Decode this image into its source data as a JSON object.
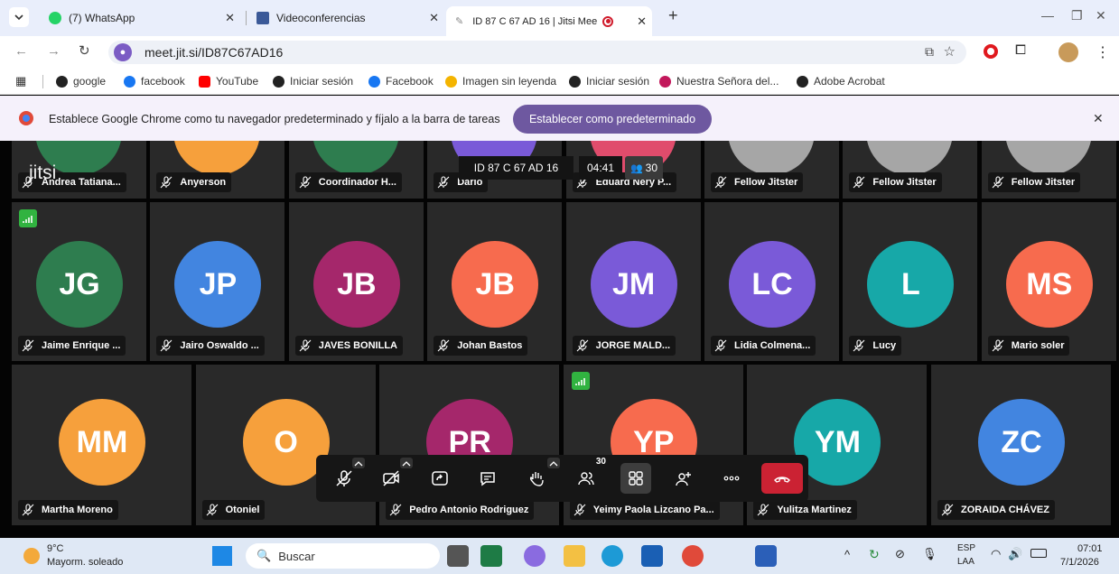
{
  "browser": {
    "tabs": [
      {
        "label": "(7) WhatsApp",
        "color": "#25d366",
        "active": false
      },
      {
        "label": "Videoconferencias",
        "color": "#3b5998",
        "active": false
      },
      {
        "label": "ID 87 C 67 AD 16 | Jitsi Mee",
        "color": "#888888",
        "active": true
      }
    ],
    "new_tab": "+",
    "address": "meet.jit.si/ID87C67AD16"
  },
  "bookmarks": [
    {
      "label": "google",
      "color": "#222222"
    },
    {
      "label": "facebook",
      "color": "#1877f2"
    },
    {
      "label": "YouTube",
      "color": "#ff0000"
    },
    {
      "label": "Iniciar sesión",
      "color": "#222222"
    },
    {
      "label": "Facebook",
      "color": "#1877f2"
    },
    {
      "label": "Imagen sin leyenda",
      "color": "#f4b400"
    },
    {
      "label": "Iniciar sesión",
      "color": "#222222"
    },
    {
      "label": "Nuestra Señora del...",
      "color": "#c2185b"
    },
    {
      "label": "Adobe Acrobat",
      "color": "#222222"
    }
  ],
  "infobar": {
    "message": "Establece Google Chrome como tu navegador predeterminado y fíjalo a la barra de tareas",
    "button": "Establecer como predeterminado"
  },
  "meeting": {
    "logo": "jitsi",
    "room": "ID 87 C 67 AD 16",
    "timer": "04:41",
    "participant_count": "30",
    "row1": [
      {
        "name": "Andrea Tatiana...",
        "color": "#2e7d4f"
      },
      {
        "name": "Anyerson",
        "color": "#f6a03c"
      },
      {
        "name": "Coordinador H...",
        "color": "#2e7d4f"
      },
      {
        "name": "Dario",
        "color": "#7a5ad8"
      },
      {
        "name": "Eduard Nery P...",
        "color": "#e04c6c"
      },
      {
        "name": "Fellow Jitster",
        "color": "#a6a6a6"
      },
      {
        "name": "Fellow Jitster",
        "color": "#a6a6a6"
      },
      {
        "name": "Fellow Jitster",
        "color": "#a6a6a6"
      }
    ],
    "row2": [
      {
        "initials": "JG",
        "name": "Jaime Enrique ...",
        "color": "#2e7d4f"
      },
      {
        "initials": "JP",
        "name": "Jairo Oswaldo ...",
        "color": "#4285e0"
      },
      {
        "initials": "JB",
        "name": "JAVES BONILLA",
        "color": "#a5276b"
      },
      {
        "initials": "JB",
        "name": "Johan Bastos",
        "color": "#f76b4e"
      },
      {
        "initials": "JM",
        "name": "JORGE MALD...",
        "color": "#7a5ad8"
      },
      {
        "initials": "LC",
        "name": "Lidia Colmena...",
        "color": "#7a5ad8"
      },
      {
        "initials": "L",
        "name": "Lucy",
        "color": "#17a8a8"
      },
      {
        "initials": "MS",
        "name": "Mario soler",
        "color": "#f76b4e"
      }
    ],
    "row3": [
      {
        "initials": "MM",
        "name": "Martha Moreno",
        "color": "#f6a03c"
      },
      {
        "initials": "O",
        "name": "Otoniel",
        "color": "#f6a03c"
      },
      {
        "initials": "PR",
        "name": "Pedro Antonio Rodriguez",
        "color": "#a5276b"
      },
      {
        "initials": "YP",
        "name": "Yeimy Paola Lizcano Pa...",
        "color": "#f76b4e"
      },
      {
        "initials": "YM",
        "name": "Yulitza Martinez",
        "color": "#17a8a8"
      },
      {
        "initials": "ZC",
        "name": "ZORAIDA CHÁVEZ",
        "color": "#4285e0"
      }
    ],
    "toolbar_badge": "30"
  },
  "taskbar": {
    "temp": "9°C",
    "weather": "Mayorm. soleado",
    "search": "Buscar",
    "lang1": "ESP",
    "lang2": "LAA",
    "time": "07:01",
    "date": "7/1/2026"
  }
}
